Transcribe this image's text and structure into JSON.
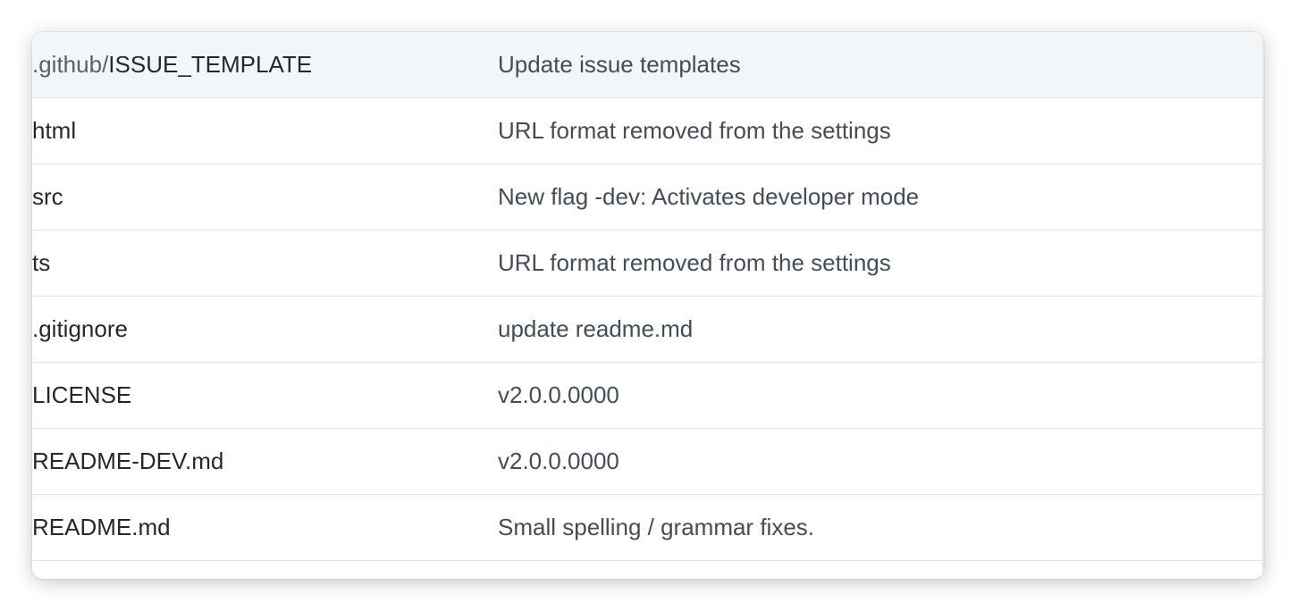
{
  "files": [
    {
      "dir": ".github/",
      "name": "ISSUE_TEMPLATE",
      "message": "Update issue templates",
      "highlighted": true
    },
    {
      "dir": "",
      "name": "html",
      "message": "URL format removed from the settings",
      "highlighted": false
    },
    {
      "dir": "",
      "name": "src",
      "message": "New flag -dev: Activates developer mode",
      "highlighted": false
    },
    {
      "dir": "",
      "name": "ts",
      "message": "URL format removed from the settings",
      "highlighted": false
    },
    {
      "dir": "",
      "name": ".gitignore",
      "message": "update readme.md",
      "highlighted": false
    },
    {
      "dir": "",
      "name": "LICENSE",
      "message": "v2.0.0.0000",
      "highlighted": false
    },
    {
      "dir": "",
      "name": "README-DEV.md",
      "message": "v2.0.0.0000",
      "highlighted": false
    },
    {
      "dir": "",
      "name": "README.md",
      "message": "Small spelling / grammar fixes.",
      "highlighted": false
    }
  ],
  "colors": {
    "highlight_row": "#f3f6f9",
    "divider": "#e1e4e8",
    "text_primary": "#24292e",
    "text_secondary": "#586069",
    "text_message": "#444d56"
  }
}
